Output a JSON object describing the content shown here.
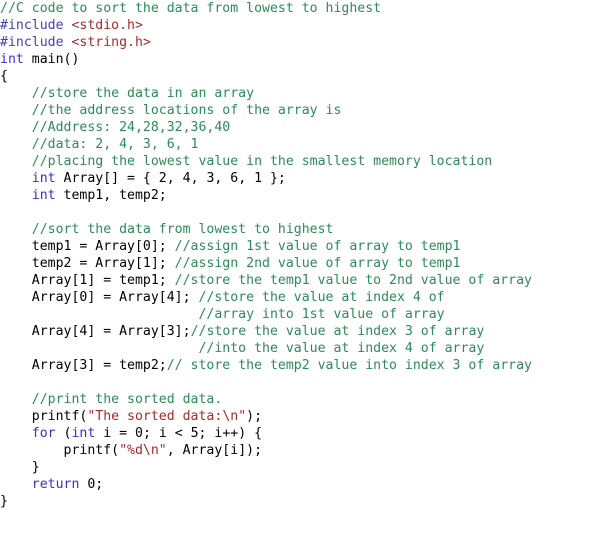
{
  "editor": {
    "language": "C",
    "background_color": "#ffffff",
    "colors": {
      "plain": "#000000",
      "comment": "#2E8B57",
      "keyword": "#3333CC",
      "string": "#A52A2A",
      "preprocessor": "#4040C0",
      "header": "#A52A2A"
    }
  },
  "code": {
    "lines": [
      {
        "n": 1,
        "tokens": [
          {
            "t": "comment",
            "s": "//C code to sort the data from lowest to highest"
          }
        ]
      },
      {
        "n": 2,
        "tokens": [
          {
            "t": "preproc",
            "s": "#include"
          },
          {
            "t": "plain",
            "s": " "
          },
          {
            "t": "header",
            "s": "<stdio.h>"
          }
        ]
      },
      {
        "n": 3,
        "tokens": [
          {
            "t": "preproc",
            "s": "#include"
          },
          {
            "t": "plain",
            "s": " "
          },
          {
            "t": "header",
            "s": "<string.h>"
          }
        ]
      },
      {
        "n": 4,
        "tokens": [
          {
            "t": "keyword",
            "s": "int"
          },
          {
            "t": "plain",
            "s": " main()"
          }
        ]
      },
      {
        "n": 5,
        "tokens": [
          {
            "t": "plain",
            "s": "{"
          }
        ]
      },
      {
        "n": 6,
        "tokens": [
          {
            "t": "comment",
            "s": "    //store the data in an array"
          }
        ]
      },
      {
        "n": 7,
        "tokens": [
          {
            "t": "comment",
            "s": "    //the address locations of the array is"
          }
        ]
      },
      {
        "n": 8,
        "tokens": [
          {
            "t": "comment",
            "s": "    //Address: 24,28,32,36,40"
          }
        ]
      },
      {
        "n": 9,
        "tokens": [
          {
            "t": "comment",
            "s": "    //data: 2, 4, 3, 6, 1"
          }
        ]
      },
      {
        "n": 10,
        "tokens": [
          {
            "t": "comment",
            "s": "    //placing the lowest value in the smallest memory location"
          }
        ]
      },
      {
        "n": 11,
        "tokens": [
          {
            "t": "plain",
            "s": "    "
          },
          {
            "t": "keyword",
            "s": "int"
          },
          {
            "t": "plain",
            "s": " Array[] = { 2, 4, 3, 6, 1 };"
          }
        ]
      },
      {
        "n": 12,
        "tokens": [
          {
            "t": "plain",
            "s": "    "
          },
          {
            "t": "keyword",
            "s": "int"
          },
          {
            "t": "plain",
            "s": " temp1, temp2;"
          }
        ]
      },
      {
        "n": 13,
        "tokens": [
          {
            "t": "plain",
            "s": ""
          }
        ]
      },
      {
        "n": 14,
        "tokens": [
          {
            "t": "comment",
            "s": "    //sort the data from lowest to highest"
          }
        ]
      },
      {
        "n": 15,
        "tokens": [
          {
            "t": "plain",
            "s": "    temp1 = Array[0]; "
          },
          {
            "t": "comment",
            "s": "//assign 1st value of array to temp1"
          }
        ]
      },
      {
        "n": 16,
        "tokens": [
          {
            "t": "plain",
            "s": "    temp2 = Array[1]; "
          },
          {
            "t": "comment",
            "s": "//assign 2nd value of array to temp1"
          }
        ]
      },
      {
        "n": 17,
        "tokens": [
          {
            "t": "plain",
            "s": "    Array[1] = temp1; "
          },
          {
            "t": "comment",
            "s": "//store the temp1 value to 2nd value of array"
          }
        ]
      },
      {
        "n": 18,
        "tokens": [
          {
            "t": "plain",
            "s": "    Array[0] = Array[4]; "
          },
          {
            "t": "comment",
            "s": "//store the value at index 4 of"
          }
        ]
      },
      {
        "n": 19,
        "tokens": [
          {
            "t": "comment",
            "s": "                         //array into 1st value of array"
          }
        ]
      },
      {
        "n": 20,
        "tokens": [
          {
            "t": "plain",
            "s": "    Array[4] = Array[3];"
          },
          {
            "t": "comment",
            "s": "//store the value at index 3 of array"
          }
        ]
      },
      {
        "n": 21,
        "tokens": [
          {
            "t": "comment",
            "s": "                         //into the value at index 4 of array"
          }
        ]
      },
      {
        "n": 22,
        "tokens": [
          {
            "t": "plain",
            "s": "    Array[3] = temp2;"
          },
          {
            "t": "comment",
            "s": "// store the temp2 value into index 3 of array"
          }
        ]
      },
      {
        "n": 23,
        "tokens": [
          {
            "t": "plain",
            "s": ""
          }
        ]
      },
      {
        "n": 24,
        "tokens": [
          {
            "t": "comment",
            "s": "    //print the sorted data."
          }
        ]
      },
      {
        "n": 25,
        "tokens": [
          {
            "t": "plain",
            "s": "    printf("
          },
          {
            "t": "string",
            "s": "\"The sorted data:\\n\""
          },
          {
            "t": "plain",
            "s": ");"
          }
        ]
      },
      {
        "n": 26,
        "tokens": [
          {
            "t": "plain",
            "s": "    "
          },
          {
            "t": "keyword",
            "s": "for"
          },
          {
            "t": "plain",
            "s": " ("
          },
          {
            "t": "keyword",
            "s": "int"
          },
          {
            "t": "plain",
            "s": " i = 0; i < 5; i++) {"
          }
        ]
      },
      {
        "n": 27,
        "tokens": [
          {
            "t": "plain",
            "s": "        printf("
          },
          {
            "t": "string",
            "s": "\"%d\\n\""
          },
          {
            "t": "plain",
            "s": ", Array[i]);"
          }
        ]
      },
      {
        "n": 28,
        "tokens": [
          {
            "t": "plain",
            "s": "    }"
          }
        ]
      },
      {
        "n": 29,
        "tokens": [
          {
            "t": "plain",
            "s": "    "
          },
          {
            "t": "keyword",
            "s": "return"
          },
          {
            "t": "plain",
            "s": " 0;"
          }
        ]
      },
      {
        "n": 30,
        "tokens": [
          {
            "t": "plain",
            "s": "}"
          }
        ]
      }
    ]
  }
}
